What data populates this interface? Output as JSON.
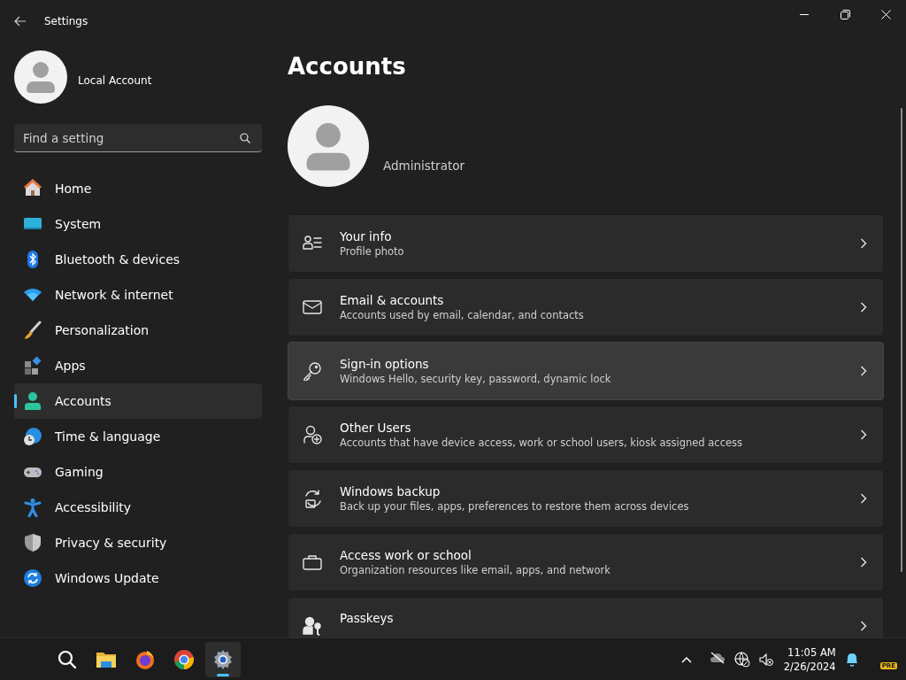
{
  "window": {
    "title": "Settings"
  },
  "account": {
    "name": "Local Account"
  },
  "search": {
    "placeholder": "Find a setting"
  },
  "nav": [
    {
      "label": "Home",
      "selected": false
    },
    {
      "label": "System",
      "selected": false
    },
    {
      "label": "Bluetooth & devices",
      "selected": false
    },
    {
      "label": "Network & internet",
      "selected": false
    },
    {
      "label": "Personalization",
      "selected": false
    },
    {
      "label": "Apps",
      "selected": false
    },
    {
      "label": "Accounts",
      "selected": true
    },
    {
      "label": "Time & language",
      "selected": false
    },
    {
      "label": "Gaming",
      "selected": false
    },
    {
      "label": "Accessibility",
      "selected": false
    },
    {
      "label": "Privacy & security",
      "selected": false
    },
    {
      "label": "Windows Update",
      "selected": false
    }
  ],
  "page": {
    "title": "Accounts",
    "user": "Administrator"
  },
  "cards": [
    {
      "title": "Your info",
      "subtitle": "Profile photo",
      "hovered": false
    },
    {
      "title": "Email & accounts",
      "subtitle": "Accounts used by email, calendar, and contacts",
      "hovered": false
    },
    {
      "title": "Sign-in options",
      "subtitle": "Windows Hello, security key, password, dynamic lock",
      "hovered": true
    },
    {
      "title": "Other Users",
      "subtitle": "Accounts that have device access, work or school users, kiosk assigned access",
      "hovered": false
    },
    {
      "title": "Windows backup",
      "subtitle": "Back up your files, apps, preferences to restore them across devices",
      "hovered": false
    },
    {
      "title": "Access work or school",
      "subtitle": "Organization resources like email, apps, and network",
      "hovered": false
    },
    {
      "title": "Passkeys",
      "hovered": false
    }
  ],
  "taskbar": {
    "apps": [
      {
        "selected": false
      },
      {
        "selected": false
      },
      {
        "selected": false
      },
      {
        "selected": false
      },
      {
        "selected": true
      }
    ],
    "time": "11:05 AM",
    "date": "2/26/2024",
    "badge": "PRE"
  }
}
